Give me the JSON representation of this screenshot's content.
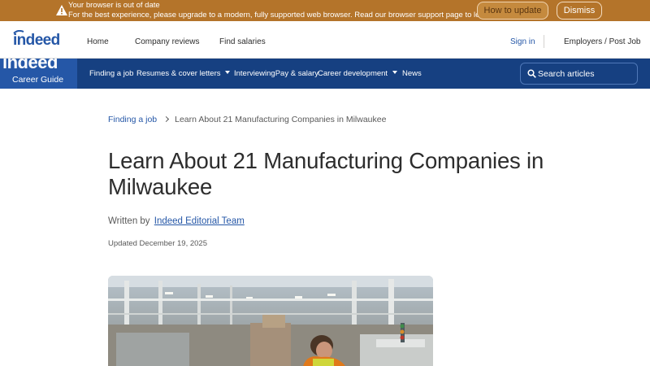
{
  "banner": {
    "title": "Your browser is out of date",
    "message": "For the best experience, please upgrade to a modern, fully supported web browser. Read our browser support page to learn more.",
    "update_label": "How to update",
    "dismiss_label": "Dismiss",
    "icon": "warning-icon"
  },
  "nav": {
    "logo_alt": "indeed",
    "home": "Home",
    "company_reviews": "Company reviews",
    "find_salaries": "Find salaries",
    "sign_in": "Sign in",
    "employers": "Employers / Post Job"
  },
  "career_guide": {
    "brand_logo": "indeed",
    "brand_label": "Career Guide",
    "items": [
      {
        "label": "Finding a job"
      },
      {
        "label": "Resumes & cover letters"
      },
      {
        "label": "Interviewing"
      },
      {
        "label": "Pay & salary"
      },
      {
        "label": "Career development"
      },
      {
        "label": "News"
      }
    ],
    "search_placeholder": "Search articles"
  },
  "article": {
    "breadcrumb": {
      "parent": "Finding a job",
      "current": "Learn About 21 Manufacturing Companies in Milwaukee"
    },
    "title": "Learn About 21 Manufacturing Companies in Milwaukee",
    "written_by": "Written by",
    "author": "Indeed Editorial Team",
    "updated": "Updated December 19, 2025"
  },
  "colors": {
    "accent": "#2557a7",
    "career_bar": "#164081",
    "banner": "#b4742a"
  }
}
